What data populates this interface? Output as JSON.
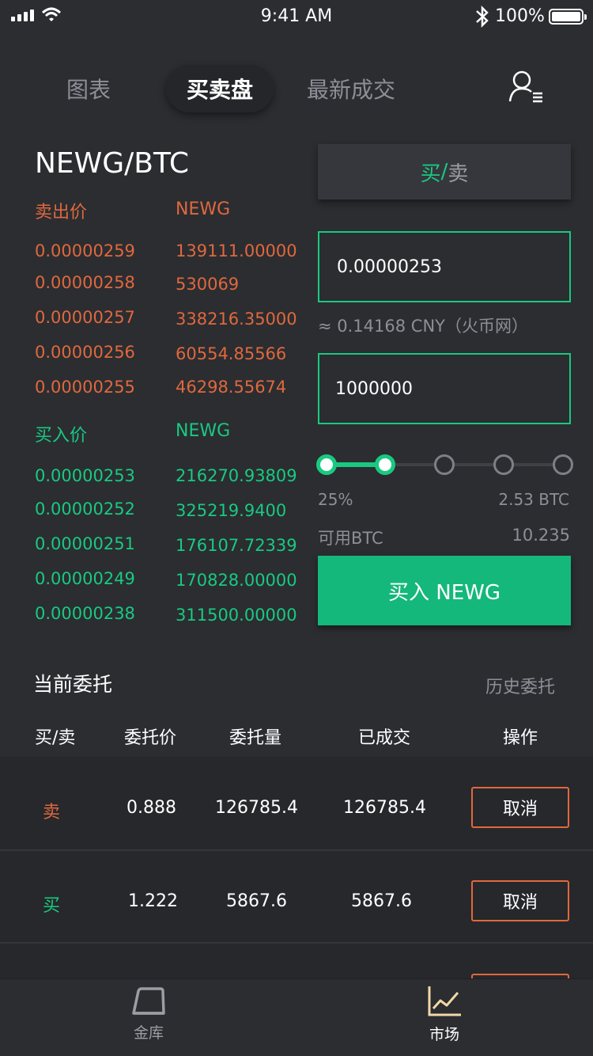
{
  "status": {
    "time": "9:41 AM",
    "battery": "100%"
  },
  "tabs": {
    "chart": "图表",
    "orderbook": "买卖盘",
    "trades": "最新成交"
  },
  "pair": "NEWG/BTC",
  "orderbook": {
    "sell_header_price": "卖出价",
    "sell_header_amount": "NEWG",
    "asks": [
      {
        "price": "0.00000259",
        "amount": "139111.00000"
      },
      {
        "price": "0.00000258",
        "amount": "530069"
      },
      {
        "price": "0.00000257",
        "amount": "338216.35000"
      },
      {
        "price": "0.00000256",
        "amount": "60554.85566"
      },
      {
        "price": "0.00000255",
        "amount": "46298.55674"
      }
    ],
    "buy_header_price": "买入价",
    "buy_header_amount": "NEWG",
    "bids": [
      {
        "price": "0.00000253",
        "amount": "216270.93809"
      },
      {
        "price": "0.00000252",
        "amount": "325219.9400"
      },
      {
        "price": "0.00000251",
        "amount": "176107.72339"
      },
      {
        "price": "0.00000249",
        "amount": "170828.00000"
      },
      {
        "price": "0.00000238",
        "amount": "311500.00000"
      }
    ]
  },
  "trade": {
    "toggle_buy": "买",
    "toggle_sep": "/",
    "toggle_sell": "卖",
    "price_value": "0.00000253",
    "cny_estimate": "≈ 0.14168 CNY（火币网）",
    "amount_value": "1000000",
    "slider_percent_label": "25%",
    "slider_level": 0.25,
    "slider_btc": "2.53 BTC",
    "available_label": "可用BTC",
    "available_value": "10.235",
    "submit_label": "买入 NEWG"
  },
  "orders": {
    "title": "当前委托",
    "history_link": "历史委托",
    "columns": [
      "买/卖",
      "委托价",
      "委托量",
      "已成交",
      "操作"
    ],
    "rows": [
      {
        "side": "卖",
        "price": "0.888",
        "amount": "126785.4",
        "filled": "126785.4",
        "action": "取消"
      },
      {
        "side": "买",
        "price": "1.222",
        "amount": "5867.6",
        "filled": "5867.6",
        "action": "取消"
      }
    ]
  },
  "tabbar": {
    "vault": "金库",
    "market": "市场"
  },
  "colors": {
    "sell": "#e0683d",
    "buy": "#19c981",
    "background": "#2b2d31",
    "accent_button": "#14b87a"
  }
}
